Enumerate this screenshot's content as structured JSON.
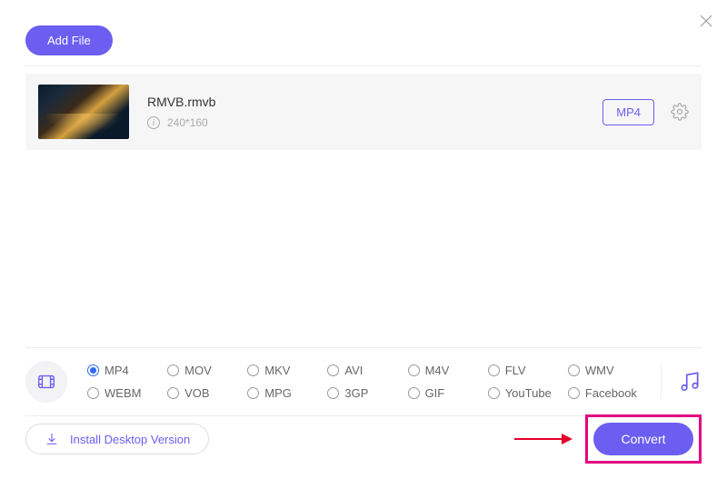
{
  "toolbar": {
    "add_file_label": "Add File"
  },
  "file": {
    "name": "RMVB.rmvb",
    "dimensions": "240*160",
    "output_format_label": "MP4"
  },
  "formats": {
    "selected": "MP4",
    "row1": [
      "MP4",
      "MOV",
      "MKV",
      "AVI",
      "M4V",
      "FLV",
      "WMV"
    ],
    "row2": [
      "WEBM",
      "VOB",
      "MPG",
      "3GP",
      "GIF",
      "YouTube",
      "Facebook"
    ]
  },
  "footer": {
    "install_label": "Install Desktop Version",
    "convert_label": "Convert"
  },
  "colors": {
    "accent": "#6b5ef0",
    "highlight": "#e4007f",
    "arrow": "#e4002b"
  }
}
